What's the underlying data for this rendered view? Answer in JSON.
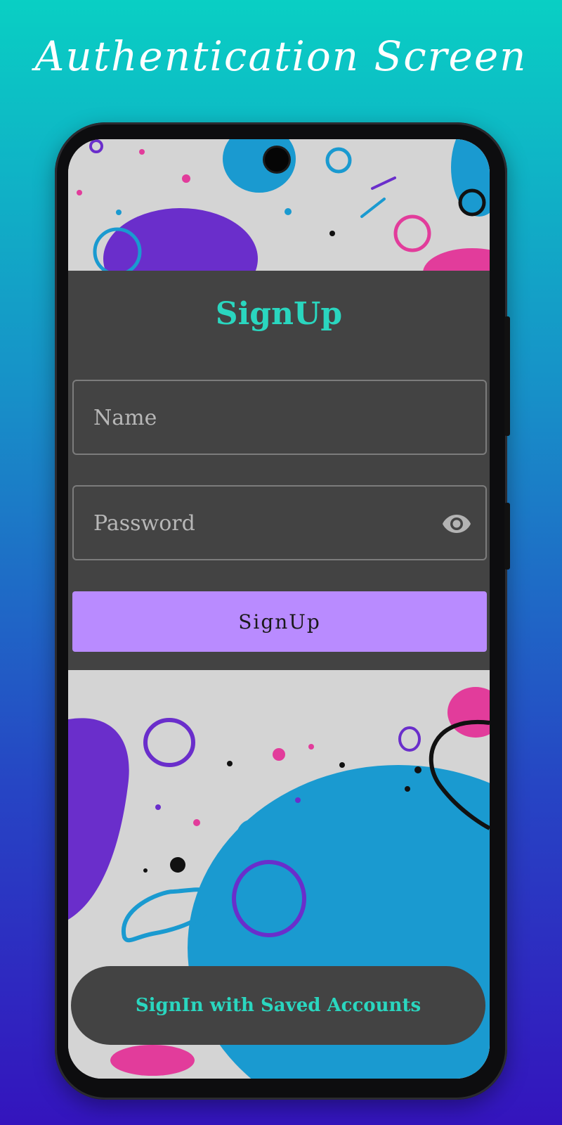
{
  "header": {
    "title": "Authentication Screen"
  },
  "signup_card": {
    "title": "SignUp",
    "name_field": {
      "placeholder": "Name",
      "value": ""
    },
    "password_field": {
      "placeholder": "Password",
      "value": "",
      "toggle_icon": "eye-icon"
    },
    "submit_label": "SignUp"
  },
  "footer": {
    "saved_accounts_label": "SignIn with Saved Accounts"
  },
  "colors": {
    "accent": "#2ad6bf",
    "button": "#b98bff",
    "card": "#434343",
    "background_top": "#09cfc4",
    "background_bottom": "#3414bd"
  }
}
